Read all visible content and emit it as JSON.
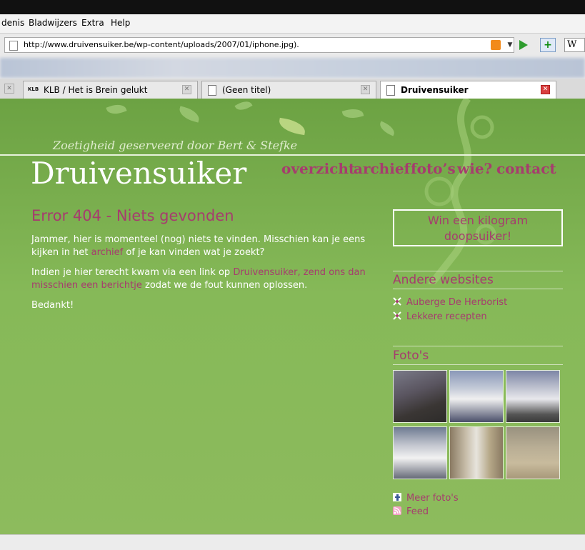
{
  "browser": {
    "menu": [
      "denis",
      "Bladwijzers",
      "Extra",
      "Help"
    ],
    "url": "http://www.druivensuiker.be/wp-content/uploads/2007/01/iphone.jpg).",
    "wiki_label": "W",
    "tabs": [
      {
        "label": "KLB / Het is Brein gelukt",
        "icon": "KLB",
        "active": false
      },
      {
        "label": "(Geen titel)",
        "active": false
      },
      {
        "label": "Druivensuiker",
        "active": true
      }
    ]
  },
  "site": {
    "tagline": "Zoetigheid geserveerd door Bert & Stefke",
    "name": "Druivensuiker",
    "nav": [
      "overzicht",
      "archief",
      "foto’s",
      "wie?",
      "contact"
    ],
    "error_title": "Error 404 - Niets gevonden",
    "p1_before": "Jammer, hier is momenteel (nog) niets te vinden. Misschien kan je eens kijken in het ",
    "p1_link": "archief",
    "p1_after": " of je kan vinden wat je zoekt?",
    "p2_before": "Indien je hier terecht kwam via een link op ",
    "p2_link1": "Druivensuiker",
    "p2_mid": ", ",
    "p2_link2": "zend ons dan misschien een berichtje",
    "p2_after": " zodat we de fout kunnen oplossen.",
    "thanks": "Bedankt!",
    "promo": "Win een kilogram doopsuiker!",
    "other_sites_title": "Andere websites",
    "other_sites": [
      "Auberge De Herborist",
      "Lekkere recepten"
    ],
    "photos_title": "Foto's",
    "more_photos": "Meer foto's",
    "feed": "Feed"
  },
  "colors": {
    "accent": "#a63c6e",
    "green": "#86b958"
  }
}
